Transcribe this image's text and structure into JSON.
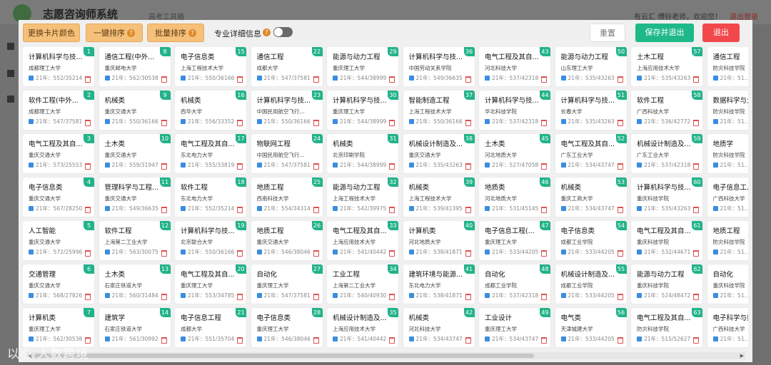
{
  "app": {
    "title": "志愿咨询师系统",
    "subtitle": "高考工具箱",
    "user_greeting": "有云汇 傅铃老师，欢迎您！",
    "logout": "退出登录",
    "nav_home": "首页"
  },
  "toolbar": {
    "change_color": "更换卡片颜色",
    "one_click_sort": "一键排序",
    "batch_sort": "批量排序",
    "detail_label": "专业详细信息",
    "help_glyph": "?",
    "detail_enabled": false,
    "reset": "重置",
    "save_exit": "保存并退出",
    "exit": "退出"
  },
  "colors": {
    "accent": "#22b38a",
    "save": "#1fb889",
    "exit": "#f2484c",
    "orange": "#f5c07a",
    "tag": "#3a8de0"
  },
  "cards": [
    {
      "n": 1,
      "name": "计算机科学与技...",
      "school": "成都理工大学",
      "score": "21年：552/35214"
    },
    {
      "n": 2,
      "name": "软件工程(中外...",
      "school": "成都理工大学",
      "score": "21年：547/37581"
    },
    {
      "n": 3,
      "name": "电气工程及其自...",
      "school": "重庆交通大学",
      "score": "21年：573/25553"
    },
    {
      "n": 4,
      "name": "电子信息类",
      "school": "重庆交通大学",
      "score": "21年：567/28250"
    },
    {
      "n": 5,
      "name": "人工智能",
      "school": "重庆交通大学",
      "score": "21年：572/25996"
    },
    {
      "n": 6,
      "name": "交通管理",
      "school": "重庆交通大学",
      "score": "21年：568/27826"
    },
    {
      "n": 7,
      "name": "计算机类",
      "school": "重庆理工大学",
      "score": "21年：562/30538"
    },
    {
      "n": 8,
      "name": "通信工程(中外...",
      "school": "重庆邮电大学",
      "score": "21年：562/30538"
    },
    {
      "n": 9,
      "name": "机械类",
      "school": "重庆交通大学",
      "score": "21年：550/36166"
    },
    {
      "n": 10,
      "name": "土木类",
      "school": "重庆交通大学",
      "score": "21年：559/31947"
    },
    {
      "n": 11,
      "name": "管理科学与工程...",
      "school": "重庆交通大学",
      "score": "21年：549/36635"
    },
    {
      "n": 12,
      "name": "软件工程",
      "school": "上海第二工业大学",
      "score": "21年：563/30075"
    },
    {
      "n": 13,
      "name": "土木类",
      "school": "石家庄铁道大学",
      "score": "21年：560/31484"
    },
    {
      "n": 14,
      "name": "建筑学",
      "school": "石家庄铁道大学",
      "score": "21年：561/30992"
    },
    {
      "n": 15,
      "name": "电子信息类",
      "school": "上海工程技术大学",
      "score": "21年：550/36166"
    },
    {
      "n": 16,
      "name": "机械类",
      "school": "西华大学",
      "score": "21年：556/33352"
    },
    {
      "n": 17,
      "name": "电气工程及其自...",
      "school": "东北电力大学",
      "score": "21年：555/33819"
    },
    {
      "n": 18,
      "name": "软件工程",
      "school": "东北电力大学",
      "score": "21年：552/35214"
    },
    {
      "n": 19,
      "name": "计算机科学与技...",
      "school": "北京联合大学",
      "score": "21年：550/36166"
    },
    {
      "n": 20,
      "name": "电气工程及其自...",
      "school": "重庆理工大学",
      "score": "21年：553/34785"
    },
    {
      "n": 21,
      "name": "电子信息工程",
      "school": "成都大学",
      "score": "21年：551/35704"
    },
    {
      "n": 22,
      "name": "通信工程",
      "school": "成都大学",
      "score": "21年：547/37581"
    },
    {
      "n": 23,
      "name": "计算机科学与技...",
      "school": "中国民用航空飞行...",
      "score": "21年：550/36166"
    },
    {
      "n": 24,
      "name": "物联网工程",
      "school": "中国民用航空飞行...",
      "score": "21年：547/37581"
    },
    {
      "n": 25,
      "name": "地质工程",
      "school": "西南科技大学",
      "score": "21年：554/34314"
    },
    {
      "n": 26,
      "name": "地质工程",
      "school": "重庆交通大学",
      "score": "21年：546/38046"
    },
    {
      "n": 27,
      "name": "自动化",
      "school": "重庆理工大学",
      "score": "21年：547/37581"
    },
    {
      "n": 28,
      "name": "电子信息类",
      "school": "重庆理工大学",
      "score": "21年：546/38046"
    },
    {
      "n": 29,
      "name": "能源与动力工程",
      "school": "重庆理工大学",
      "score": "21年：544/38999"
    },
    {
      "n": 30,
      "name": "计算机科学与技...",
      "school": "重庆理工大学",
      "score": "21年：544/38999"
    },
    {
      "n": 31,
      "name": "机械类",
      "school": "北京印刷学院",
      "score": "21年：544/38999"
    },
    {
      "n": 32,
      "name": "能源与动力工程",
      "school": "上海工程技术大学",
      "score": "21年：542/39975"
    },
    {
      "n": 33,
      "name": "电气工程及其自...",
      "school": "上海应用技术大学",
      "score": "21年：541/40442"
    },
    {
      "n": 34,
      "name": "工业工程",
      "school": "上海第二工业大学",
      "score": "21年：540/40930"
    },
    {
      "n": 35,
      "name": "机械设计制造及...",
      "school": "上海应用技术大学",
      "score": "21年：541/40442"
    },
    {
      "n": 36,
      "name": "计算机科学与技...",
      "school": "中国劳动关系学院",
      "score": "21年：549/36635"
    },
    {
      "n": 37,
      "name": "智能制造工程",
      "school": "上海工程技术大学",
      "score": "21年：550/36166"
    },
    {
      "n": 38,
      "name": "机械设计制造及...",
      "school": "重庆交通大学",
      "score": "21年：535/43263"
    },
    {
      "n": 39,
      "name": "机械类",
      "school": "上海工程技术大学",
      "score": "21年：539/41395"
    },
    {
      "n": 40,
      "name": "计算机类",
      "school": "河北地质大学",
      "score": "21年：538/41871"
    },
    {
      "n": 41,
      "name": "建筑环境与能源...",
      "school": "东北电力大学",
      "score": "21年：538/41871"
    },
    {
      "n": 42,
      "name": "机械类",
      "school": "河北科技大学",
      "score": "21年：534/43747"
    },
    {
      "n": 43,
      "name": "电气工程及其自...",
      "school": "河北科技大学",
      "score": "21年：537/42318"
    },
    {
      "n": 44,
      "name": "计算机科学与技...",
      "school": "华北科技学院",
      "score": "21年：537/42318"
    },
    {
      "n": 45,
      "name": "土木类",
      "school": "河北地质大学",
      "score": "21年：527/47058"
    },
    {
      "n": 46,
      "name": "地质类",
      "school": "河北地质大学",
      "score": "21年：531/45145"
    },
    {
      "n": 47,
      "name": "电子信息工程(...",
      "school": "重庆理工大学",
      "score": "21年：533/44205"
    },
    {
      "n": 48,
      "name": "自动化",
      "school": "成都工业学院",
      "score": "21年：537/42318"
    },
    {
      "n": 49,
      "name": "工业设计",
      "school": "重庆理工大学",
      "score": "21年：534/43747"
    },
    {
      "n": 50,
      "name": "能源与动力工程",
      "school": "山东理工大学",
      "score": "21年：535/43263"
    },
    {
      "n": 51,
      "name": "计算机科学与技...",
      "school": "长春大学",
      "score": "21年：535/43263"
    },
    {
      "n": 52,
      "name": "电气工程及其自...",
      "school": "广东工业大学",
      "score": "21年：534/43747"
    },
    {
      "n": 53,
      "name": "机械类",
      "school": "重庆工商大学",
      "score": "21年：534/43747"
    },
    {
      "n": 54,
      "name": "电子信息类",
      "school": "成都工业学院",
      "score": "21年：533/44205"
    },
    {
      "n": 55,
      "name": "机械设计制造及...",
      "school": "成都工业学院",
      "score": "21年：533/44205"
    },
    {
      "n": 56,
      "name": "电气类",
      "school": "天津城建大学",
      "score": "21年：533/44205"
    },
    {
      "n": 57,
      "name": "土木工程",
      "school": "上海应用技术大学",
      "score": "21年：535/43263"
    },
    {
      "n": 58,
      "name": "软件工程",
      "school": "广西科技大学",
      "score": "21年：536/42772"
    },
    {
      "n": 59,
      "name": "机械设计制造及...",
      "school": "广东工业大学",
      "score": "21年：537/42318"
    },
    {
      "n": 60,
      "name": "计算机科学与技...",
      "school": "重庆科技学院",
      "score": "21年：535/43263"
    },
    {
      "n": 61,
      "name": "电气工程及其自...",
      "school": "重庆科技学院",
      "score": "21年：532/44671"
    },
    {
      "n": 62,
      "name": "能源与动力工程",
      "school": "重庆科技学院",
      "score": "21年：524/48472"
    },
    {
      "n": 63,
      "name": "电气工程及其自...",
      "school": "防灾科技学院",
      "score": "21年：515/52627"
    },
    {
      "n": 64,
      "name": "通信工程",
      "school": "防灾科技学院",
      "score": "21年：51..."
    },
    {
      "n": 65,
      "name": "数据科学与大...",
      "school": "防灾科技学院",
      "score": "21年：51..."
    },
    {
      "n": 66,
      "name": "地质学",
      "school": "防灾科技学院",
      "score": "21年：51..."
    },
    {
      "n": 67,
      "name": "电子信息工...",
      "school": "广西科技大学",
      "score": "21年：51..."
    },
    {
      "n": 68,
      "name": "地质工程",
      "school": "防灾科技学院",
      "score": "21年：51..."
    },
    {
      "n": 69,
      "name": "自动化",
      "school": "重庆科技学院",
      "score": "21年：51..."
    },
    {
      "n": 70,
      "name": "电子科学与技...",
      "school": "广西科技大学",
      "score": "21年：51..."
    }
  ],
  "watermark": "以心 人数跨境"
}
